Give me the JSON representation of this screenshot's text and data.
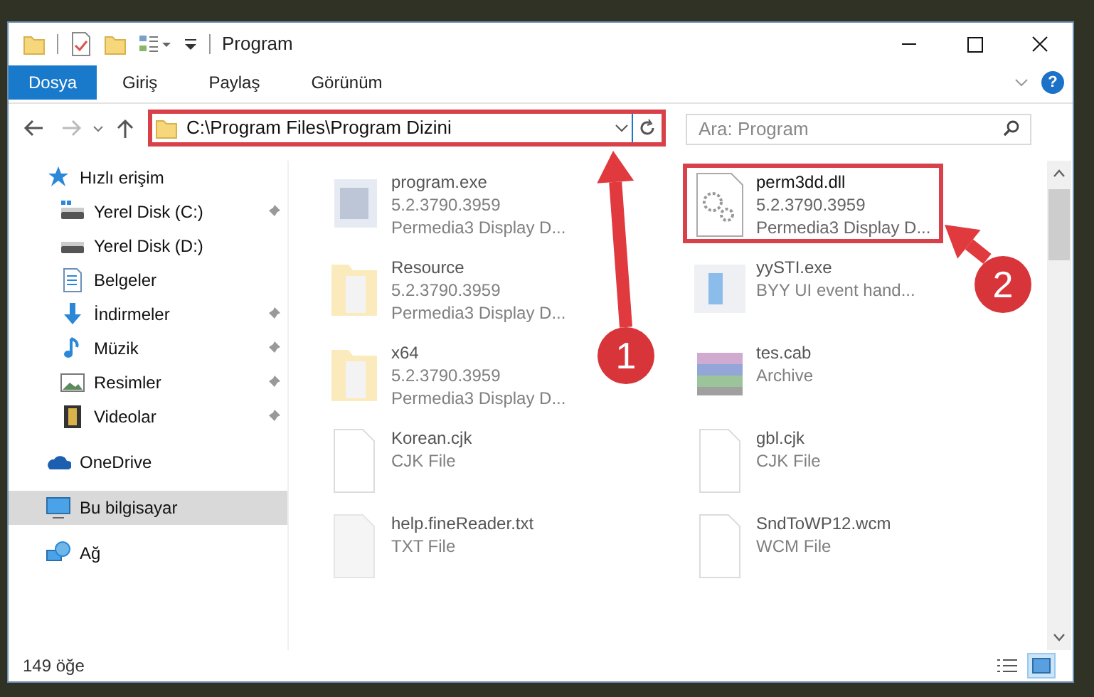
{
  "window": {
    "title": "Program"
  },
  "ribbon": {
    "tabs": [
      {
        "label": "Dosya",
        "selected": true
      },
      {
        "label": "Giriş",
        "selected": false
      },
      {
        "label": "Paylaş",
        "selected": false
      },
      {
        "label": "Görünüm",
        "selected": false
      }
    ],
    "help_glyph": "?"
  },
  "address": {
    "path": "C:\\Program Files\\Program Dizini",
    "highlighted": true
  },
  "search": {
    "placeholder": "Ara: Program"
  },
  "sidebar": {
    "items": [
      {
        "label": "Hızlı erişim",
        "kind": "star",
        "selected": false,
        "children": [
          {
            "label": "Yerel Disk (C:)",
            "kind": "drive-c",
            "pinned": true,
            "selected": false
          },
          {
            "label": "Yerel Disk (D:)",
            "kind": "drive",
            "pinned": false,
            "selected": false
          },
          {
            "label": "Belgeler",
            "kind": "documents",
            "pinned": false,
            "selected": false
          },
          {
            "label": "İndirmeler",
            "kind": "download",
            "pinned": true,
            "selected": false
          },
          {
            "label": "Müzik",
            "kind": "music",
            "pinned": true,
            "selected": false
          },
          {
            "label": "Resimler",
            "kind": "pictures",
            "pinned": true,
            "selected": false
          },
          {
            "label": "Videolar",
            "kind": "videos",
            "pinned": true,
            "selected": false
          }
        ]
      },
      {
        "label": "OneDrive",
        "kind": "cloud",
        "selected": false
      },
      {
        "label": "Bu bilgisayar",
        "kind": "computer",
        "selected": true
      },
      {
        "label": "Ağ",
        "kind": "network",
        "selected": false
      }
    ]
  },
  "files": [
    {
      "name": "program.exe",
      "details": [
        "5.2.3790.3959",
        "Permedia3 Display D..."
      ],
      "kind": "exe",
      "blurred": true,
      "highlighted": false
    },
    {
      "name": "perm3dd.dll",
      "details": [
        "5.2.3790.3959",
        "Permedia3 Display D..."
      ],
      "kind": "dll",
      "blurred": false,
      "highlighted": true
    },
    {
      "name": "Resource",
      "details": [
        "5.2.3790.3959",
        "Permedia3 Display D..."
      ],
      "kind": "folder",
      "blurred": true,
      "highlighted": false
    },
    {
      "name": "yySTI.exe",
      "details": [
        "BYY UI event hand..."
      ],
      "kind": "app",
      "blurred": true,
      "highlighted": false
    },
    {
      "name": "x64",
      "details": [
        "5.2.3790.3959",
        "Permedia3 Display D..."
      ],
      "kind": "folder",
      "blurred": true,
      "highlighted": false
    },
    {
      "name": "tes.cab",
      "details": [
        "Archive"
      ],
      "kind": "archive",
      "blurred": true,
      "highlighted": false
    },
    {
      "name": "Korean.cjk",
      "details": [
        "CJK File"
      ],
      "kind": "file",
      "blurred": true,
      "highlighted": false
    },
    {
      "name": "gbl.cjk",
      "details": [
        "CJK File"
      ],
      "kind": "file",
      "blurred": true,
      "highlighted": false
    },
    {
      "name": "help.fineReader.txt",
      "details": [
        "TXT File"
      ],
      "kind": "text",
      "blurred": true,
      "highlighted": false
    },
    {
      "name": "SndToWP12.wcm",
      "details": [
        "WCM File"
      ],
      "kind": "file",
      "blurred": true,
      "highlighted": false
    }
  ],
  "status_bar": {
    "count": "149 öğe",
    "views": [
      {
        "kind": "details",
        "selected": false
      },
      {
        "kind": "large-icons",
        "selected": true
      }
    ]
  },
  "annotations": [
    {
      "number": "1"
    },
    {
      "number": "2"
    }
  ]
}
